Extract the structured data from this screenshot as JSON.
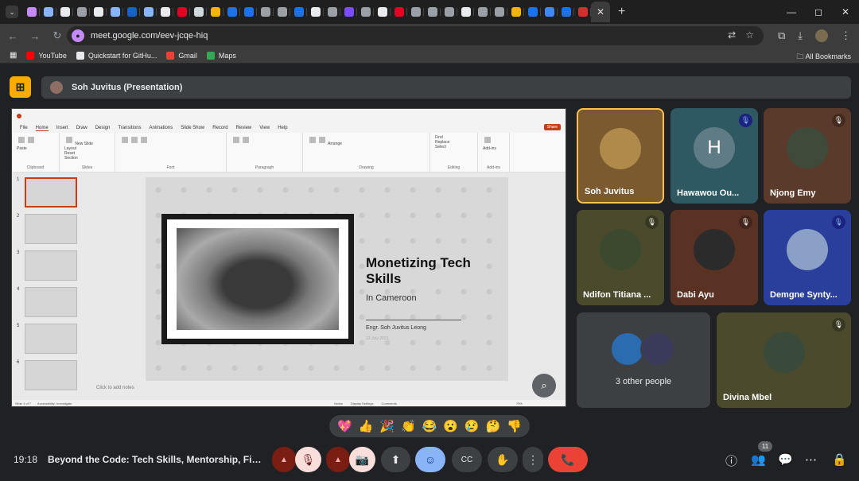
{
  "browser": {
    "tab_icon_colors": [
      "#c58af9",
      "#8ab4f8",
      "#e8eaed",
      "#9aa0a6",
      "#e8eaed",
      "#8ab4f8",
      "#1565c0",
      "#8ab4f8",
      "#e8eaed",
      "#e60023",
      "#cfd8dc",
      "#f4b400",
      "#1a73e8",
      "#1a73e8",
      "#9aa0a6",
      "#9aa0a6",
      "#1a73e8",
      "#e8eaed",
      "#9aa0a6",
      "#7c4dff",
      "#9aa0a6",
      "#e8eaed",
      "#e60023",
      "#9aa0a6",
      "#9aa0a6",
      "#9aa0a6",
      "#e8eaed",
      "#9aa0a6",
      "#9aa0a6",
      "#f4b400",
      "#1a73e8",
      "#4285f4",
      "#1a73e8",
      "#d32f2f"
    ],
    "active_tab_close": "✕",
    "new_tab": "+",
    "window_controls": [
      "—",
      "◻",
      "✕"
    ],
    "url": "meet.google.com/eev-jcqe-hiq",
    "bookmarks": [
      {
        "label": "YouTube",
        "color": "#ff0000"
      },
      {
        "label": "Quickstart for GitHu...",
        "color": "#e8eaed"
      },
      {
        "label": "Gmail",
        "color": "#ea4335"
      },
      {
        "label": "Maps",
        "color": "#34a853"
      }
    ],
    "all_bookmarks": "All Bookmarks"
  },
  "meet": {
    "presenter_bar": "Soh Juvitus (Presentation)",
    "clock": "19:18",
    "meeting_title": "Beyond the Code: Tech Skills, Mentorship, Financi...",
    "participants_count": "11",
    "reactions": [
      "💖",
      "👍",
      "🎉",
      "👏",
      "😂",
      "😮",
      "😢",
      "🤔",
      "👎"
    ]
  },
  "ppt": {
    "menu": [
      "File",
      "Home",
      "Insert",
      "Draw",
      "Design",
      "Transitions",
      "Animations",
      "Slide Show",
      "Record",
      "Review",
      "View",
      "Help"
    ],
    "share": "Share",
    "ribbon_groups": [
      "Clipboard",
      "Slides",
      "Font",
      "Paragraph",
      "Drawing",
      "Editing",
      "Add-ins"
    ],
    "ribbon_labels": [
      "Paste",
      "New Slide",
      "Layout",
      "Reset",
      "Section",
      "Arrange",
      "Find",
      "Replace",
      "Select",
      "Add-ins"
    ],
    "slide_numbers": [
      "1",
      "2",
      "3",
      "4",
      "5",
      "6"
    ],
    "slide_title": "Monetizing Tech Skills",
    "slide_subtitle": "In Cameroon",
    "slide_author": "Engr. Soh Juvitus Leong",
    "slide_date": "13 July 2023",
    "notes_placeholder": "Click to add notes",
    "status_left": "Slide 1 of 7",
    "status_access": "Accessibility: Investigate",
    "status_right": [
      "Notes",
      "Display Settings",
      "Comments",
      "79%"
    ]
  },
  "tiles": [
    {
      "name": "Soh Juvitus",
      "bg": "#7a5a2e",
      "circle": "#b08a4a",
      "muted": false,
      "highlight": true
    },
    {
      "name": "Hawawou Ou...",
      "bg": "#2e5963",
      "circle": "#5f7c86",
      "initial": "H",
      "muted": true,
      "mute_style": "blue"
    },
    {
      "name": "Njong Emy",
      "bg": "#5a3a2a",
      "circle": "#3f4a3a",
      "muted": true,
      "mute_style": "dark"
    },
    {
      "name": "Ndifon Titiana ...",
      "bg": "#4b4a2c",
      "circle": "#3b4a2e",
      "muted": true,
      "mute_style": "dark"
    },
    {
      "name": "Dabi Ayu",
      "bg": "#5a3224",
      "circle": "#2b2b2b",
      "muted": true,
      "mute_style": "dark"
    },
    {
      "name": "Demgne Synty...",
      "bg": "#2a3f9c",
      "circle": "#8aa0c6",
      "muted": true,
      "mute_style": "blue"
    },
    {
      "name": "Divina Mbel",
      "bg": "#4b4a2c",
      "circle": "#3a4a3a",
      "muted": true,
      "mute_style": "dark"
    }
  ],
  "others_label": "3 other people",
  "controls": {
    "mic_icon": "🎙",
    "cam_icon": "📷",
    "present_icon": "⬆",
    "emoji_icon": "☺",
    "cc_icon": "CC",
    "hand_icon": "✋",
    "more_icon": "⋮",
    "hangup_icon": "📞",
    "info_icon": "ⓘ",
    "people_icon": "👥",
    "chat_icon": "💬",
    "activities_icon": "⋯",
    "lock_icon": "🔒"
  }
}
